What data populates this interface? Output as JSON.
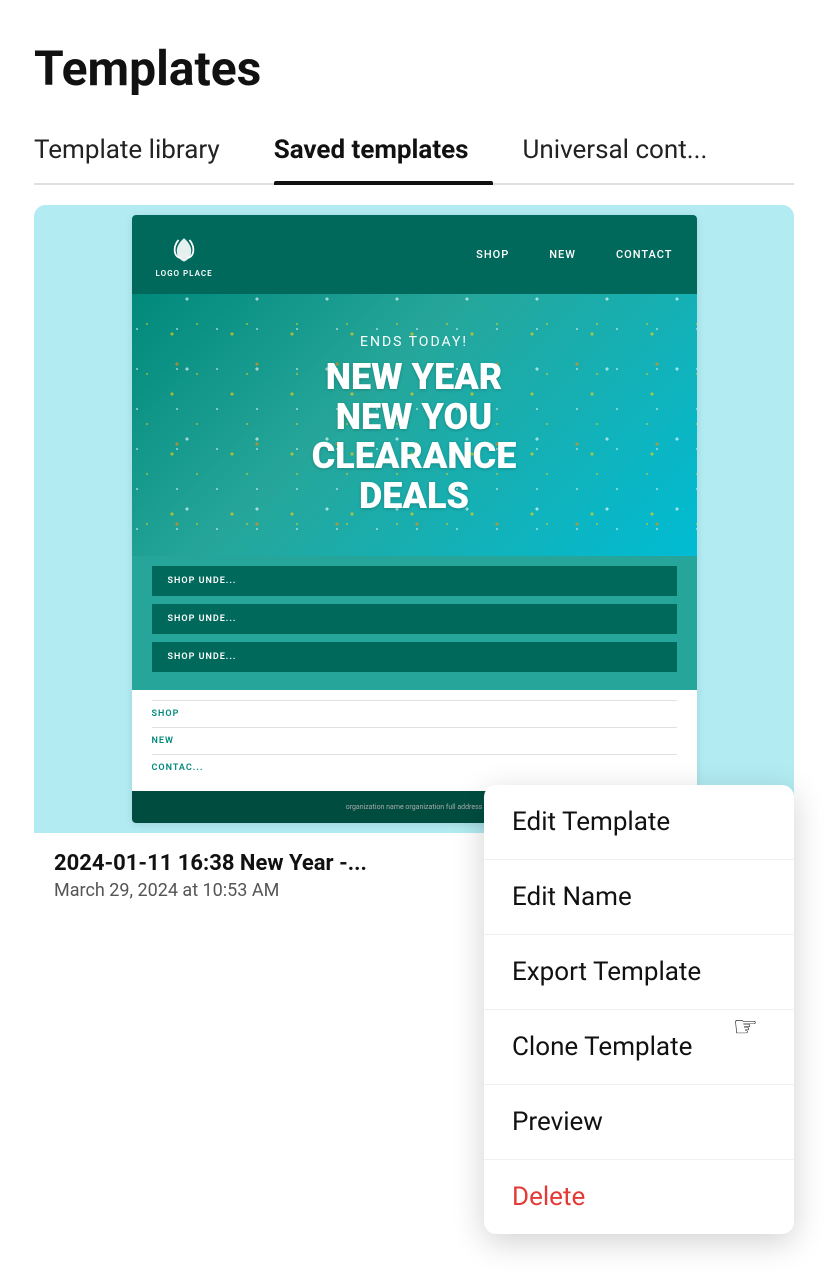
{
  "page": {
    "title": "Templates"
  },
  "tabs": [
    {
      "id": "library",
      "label": "Template library",
      "active": false
    },
    {
      "id": "saved",
      "label": "Saved templates",
      "active": true
    },
    {
      "id": "universal",
      "label": "Universal cont...",
      "active": false
    }
  ],
  "template_card": {
    "email": {
      "logo_text": "LOGO PLACE",
      "nav_links": [
        "SHOP",
        "NEW",
        "CONTACT"
      ],
      "ends_today": "ENDS TODAY!",
      "headline_line1": "NEW YEAR",
      "headline_line2": "NEW YOU",
      "headline_line3": "CLEARANCE",
      "headline_line4": "DEALS",
      "shop_buttons": [
        "SHOP UNDE...",
        "SHOP UNDE...",
        "SHOP UNDE..."
      ],
      "footer_links": [
        "SHOP",
        "NEW",
        "CONTAC..."
      ],
      "footer_text": "organization name organization full address"
    },
    "name": "2024-01-11 16:38 New Year -...",
    "date": "March 29, 2024 at 10:53 AM"
  },
  "context_menu": {
    "items": [
      {
        "id": "edit-template",
        "label": "Edit Template",
        "color": "normal"
      },
      {
        "id": "edit-name",
        "label": "Edit Name",
        "color": "normal"
      },
      {
        "id": "export-template",
        "label": "Export Template",
        "color": "normal"
      },
      {
        "id": "clone-template",
        "label": "Clone Template",
        "color": "normal"
      },
      {
        "id": "preview",
        "label": "Preview",
        "color": "normal"
      },
      {
        "id": "delete",
        "label": "Delete",
        "color": "delete"
      }
    ]
  }
}
